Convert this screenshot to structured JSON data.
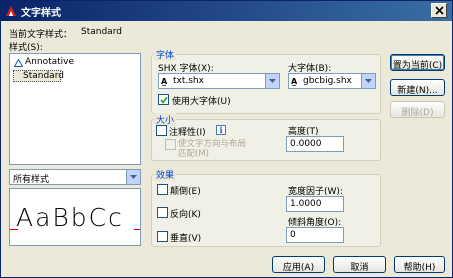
{
  "window": {
    "title": "文字样式"
  },
  "current_style": {
    "label": "当前文字样式：",
    "value": "Standard"
  },
  "styles": {
    "label": "样式(S):",
    "items": [
      {
        "name": "Annotative",
        "annotative": true
      },
      {
        "name": "Standard",
        "selected": true
      }
    ],
    "filter_value": "所有样式"
  },
  "preview": {
    "sample_text": "AaBbCc"
  },
  "font_group": {
    "title": "字体",
    "shx_font_label": "SHX 字体(X):",
    "shx_font_value": "txt.shx",
    "big_font_label": "大字体(B):",
    "big_font_value": "gbcbig.shx",
    "use_big_font_label": "使用大字体(U)",
    "use_big_font_checked": true
  },
  "size_group": {
    "title": "大小",
    "annotative_label": "注释性(I)",
    "annotative_checked": false,
    "info_glyph": "i",
    "match_orientation_label_line1": "使文字方向与布局",
    "match_orientation_label_line2": "匹配(M)",
    "height_label": "高度(T)",
    "height_value": "0.0000"
  },
  "effects_group": {
    "title": "效果",
    "upside_down_label": "颠倒(E)",
    "backwards_label": "反向(K)",
    "vertical_label": "垂直(V)",
    "width_factor_label": "宽度因子(W):",
    "width_factor_value": "1.0000",
    "oblique_angle_label": "倾斜角度(O):",
    "oblique_angle_value": "0"
  },
  "buttons": {
    "set_current": "置为当前(C)",
    "new": "新建(N)...",
    "delete": "删除(D)",
    "apply": "应用(A)",
    "cancel": "取消",
    "help": "帮助(H)"
  },
  "colors": {
    "title_bar": "#0a246a",
    "group_title": "#0046d5",
    "preview_stroke": "#000000",
    "baseline_marker": "#cc0000"
  }
}
